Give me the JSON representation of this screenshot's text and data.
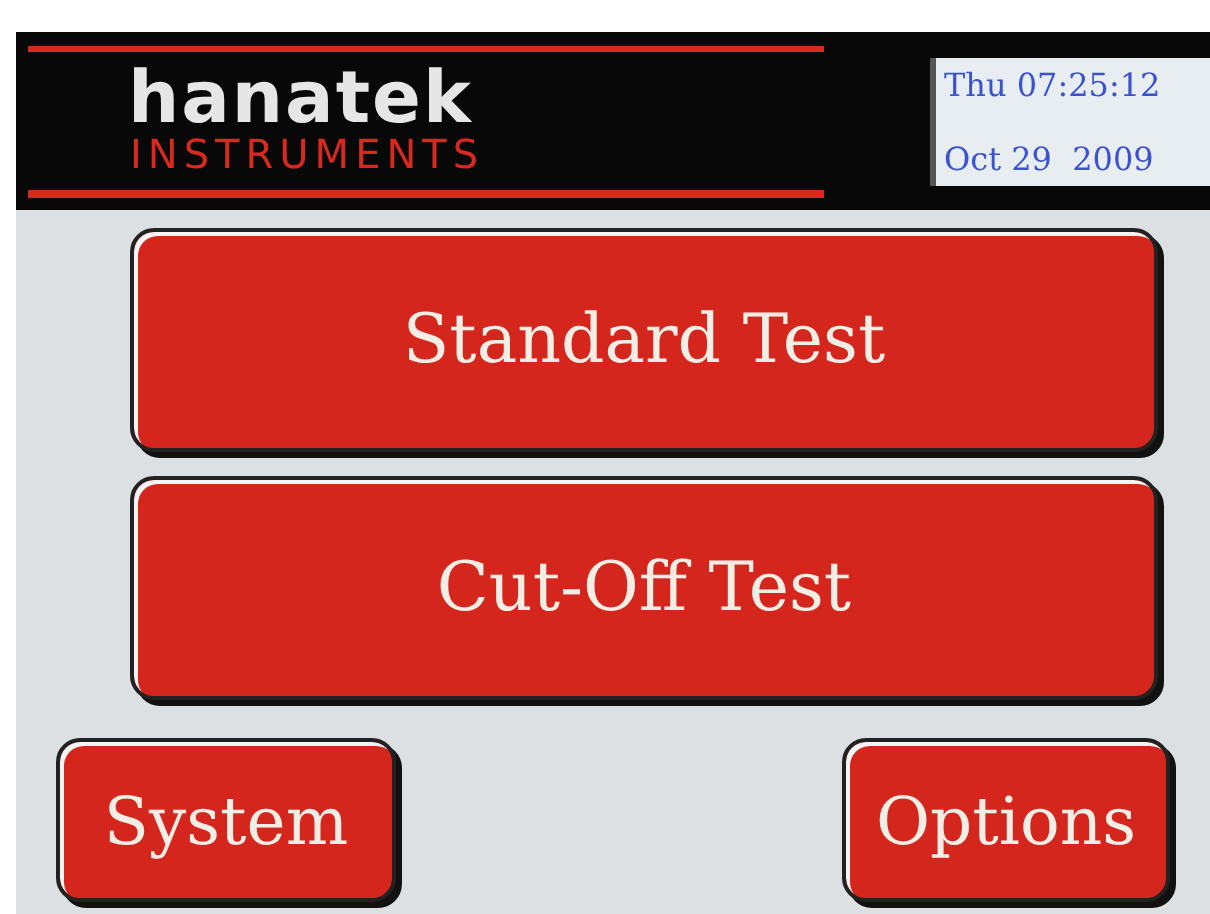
{
  "header": {
    "logo": {
      "name": "hanatek",
      "tagline": "INSTRUMENTS"
    },
    "clock": {
      "time_line": "Thu 07:25:12",
      "date_line": "Oct 29  2009"
    }
  },
  "main_buttons": [
    "Standard Test",
    "Cut-Off Test"
  ],
  "bottom_buttons": [
    "System",
    "Options"
  ]
}
